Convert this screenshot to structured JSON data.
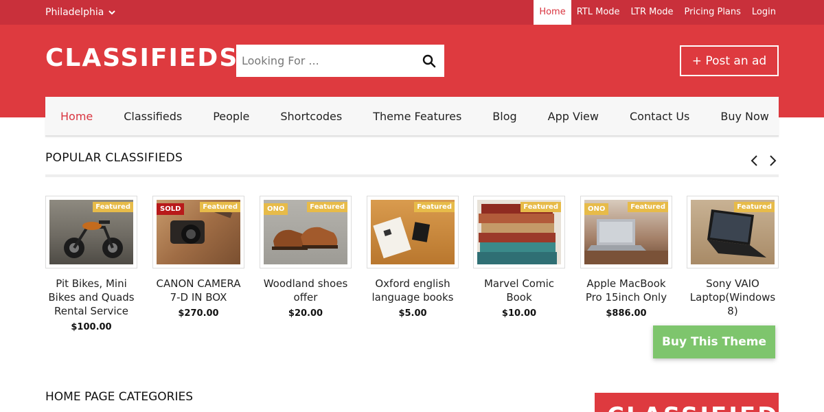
{
  "topbar": {
    "city": "Philadelphia",
    "links": [
      "Home",
      "RTL Mode",
      "LTR Mode",
      "Pricing Plans",
      "Login"
    ]
  },
  "header": {
    "logo": "CLASSIFIEDS",
    "search_placeholder": "Looking For ...",
    "post_ad": "+ Post an ad"
  },
  "nav": {
    "items": [
      "Home",
      "Classifieds",
      "People",
      "Shortcodes",
      "Theme Features",
      "Blog",
      "App View",
      "Contact Us",
      "Buy Now"
    ]
  },
  "popular": {
    "title": "POPULAR CLASSIFIEDS",
    "items": [
      {
        "title": "Pit Bikes, Mini Bikes and Quads Rental Service",
        "price": "$100.00",
        "featured": "Featured",
        "tag": ""
      },
      {
        "title": "CANON CAMERA 7-D IN BOX",
        "price": "$270.00",
        "featured": "Featured",
        "tag": "SOLD"
      },
      {
        "title": "Woodland shoes offer",
        "price": "$20.00",
        "featured": "Featured",
        "tag": "ONO"
      },
      {
        "title": "Oxford english language books",
        "price": "$5.00",
        "featured": "Featured",
        "tag": ""
      },
      {
        "title": "Marvel Comic Book",
        "price": "$10.00",
        "featured": "Featured",
        "tag": ""
      },
      {
        "title": "Apple MacBook Pro 15inch Only",
        "price": "$886.00",
        "featured": "Featured",
        "tag": "ONO"
      },
      {
        "title": "Sony VAIO Laptop(Windows 8)",
        "price": "",
        "featured": "Featured",
        "tag": ""
      }
    ]
  },
  "buy_theme": "Buy This Theme",
  "categories": {
    "title": "HOME PAGE CATEGORIES"
  },
  "promo": {
    "text": "CLASSIFIEDS"
  },
  "colors": {
    "brand_red": "#de3a3f",
    "topbar_red": "#c9303b",
    "featured": "#e7bb49",
    "sold": "#b81a1a",
    "buy_green": "#7ec56d"
  }
}
